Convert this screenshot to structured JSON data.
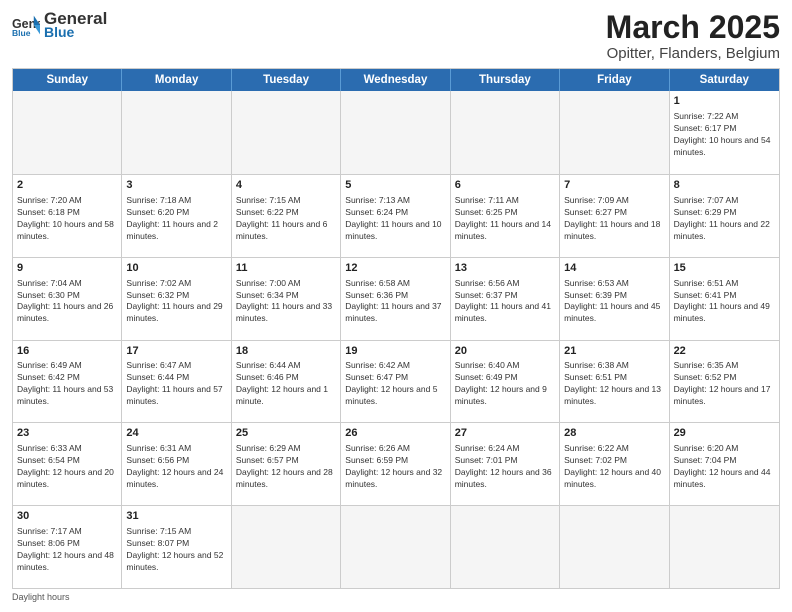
{
  "header": {
    "logo_general": "General",
    "logo_blue": "Blue",
    "month": "March 2025",
    "location": "Opitter, Flanders, Belgium"
  },
  "days": [
    "Sunday",
    "Monday",
    "Tuesday",
    "Wednesday",
    "Thursday",
    "Friday",
    "Saturday"
  ],
  "weeks": [
    [
      {
        "day": "",
        "empty": true
      },
      {
        "day": "",
        "empty": true
      },
      {
        "day": "",
        "empty": true
      },
      {
        "day": "",
        "empty": true
      },
      {
        "day": "",
        "empty": true
      },
      {
        "day": "",
        "empty": true
      },
      {
        "day": "1",
        "sunrise": "Sunrise: 7:22 AM",
        "sunset": "Sunset: 6:17 PM",
        "daylight": "Daylight: 10 hours and 54 minutes."
      }
    ],
    [
      {
        "day": "2",
        "sunrise": "Sunrise: 7:20 AM",
        "sunset": "Sunset: 6:18 PM",
        "daylight": "Daylight: 10 hours and 58 minutes."
      },
      {
        "day": "3",
        "sunrise": "Sunrise: 7:18 AM",
        "sunset": "Sunset: 6:20 PM",
        "daylight": "Daylight: 11 hours and 2 minutes."
      },
      {
        "day": "4",
        "sunrise": "Sunrise: 7:15 AM",
        "sunset": "Sunset: 6:22 PM",
        "daylight": "Daylight: 11 hours and 6 minutes."
      },
      {
        "day": "5",
        "sunrise": "Sunrise: 7:13 AM",
        "sunset": "Sunset: 6:24 PM",
        "daylight": "Daylight: 11 hours and 10 minutes."
      },
      {
        "day": "6",
        "sunrise": "Sunrise: 7:11 AM",
        "sunset": "Sunset: 6:25 PM",
        "daylight": "Daylight: 11 hours and 14 minutes."
      },
      {
        "day": "7",
        "sunrise": "Sunrise: 7:09 AM",
        "sunset": "Sunset: 6:27 PM",
        "daylight": "Daylight: 11 hours and 18 minutes."
      },
      {
        "day": "8",
        "sunrise": "Sunrise: 7:07 AM",
        "sunset": "Sunset: 6:29 PM",
        "daylight": "Daylight: 11 hours and 22 minutes."
      }
    ],
    [
      {
        "day": "9",
        "sunrise": "Sunrise: 7:04 AM",
        "sunset": "Sunset: 6:30 PM",
        "daylight": "Daylight: 11 hours and 26 minutes."
      },
      {
        "day": "10",
        "sunrise": "Sunrise: 7:02 AM",
        "sunset": "Sunset: 6:32 PM",
        "daylight": "Daylight: 11 hours and 29 minutes."
      },
      {
        "day": "11",
        "sunrise": "Sunrise: 7:00 AM",
        "sunset": "Sunset: 6:34 PM",
        "daylight": "Daylight: 11 hours and 33 minutes."
      },
      {
        "day": "12",
        "sunrise": "Sunrise: 6:58 AM",
        "sunset": "Sunset: 6:36 PM",
        "daylight": "Daylight: 11 hours and 37 minutes."
      },
      {
        "day": "13",
        "sunrise": "Sunrise: 6:56 AM",
        "sunset": "Sunset: 6:37 PM",
        "daylight": "Daylight: 11 hours and 41 minutes."
      },
      {
        "day": "14",
        "sunrise": "Sunrise: 6:53 AM",
        "sunset": "Sunset: 6:39 PM",
        "daylight": "Daylight: 11 hours and 45 minutes."
      },
      {
        "day": "15",
        "sunrise": "Sunrise: 6:51 AM",
        "sunset": "Sunset: 6:41 PM",
        "daylight": "Daylight: 11 hours and 49 minutes."
      }
    ],
    [
      {
        "day": "16",
        "sunrise": "Sunrise: 6:49 AM",
        "sunset": "Sunset: 6:42 PM",
        "daylight": "Daylight: 11 hours and 53 minutes."
      },
      {
        "day": "17",
        "sunrise": "Sunrise: 6:47 AM",
        "sunset": "Sunset: 6:44 PM",
        "daylight": "Daylight: 11 hours and 57 minutes."
      },
      {
        "day": "18",
        "sunrise": "Sunrise: 6:44 AM",
        "sunset": "Sunset: 6:46 PM",
        "daylight": "Daylight: 12 hours and 1 minute."
      },
      {
        "day": "19",
        "sunrise": "Sunrise: 6:42 AM",
        "sunset": "Sunset: 6:47 PM",
        "daylight": "Daylight: 12 hours and 5 minutes."
      },
      {
        "day": "20",
        "sunrise": "Sunrise: 6:40 AM",
        "sunset": "Sunset: 6:49 PM",
        "daylight": "Daylight: 12 hours and 9 minutes."
      },
      {
        "day": "21",
        "sunrise": "Sunrise: 6:38 AM",
        "sunset": "Sunset: 6:51 PM",
        "daylight": "Daylight: 12 hours and 13 minutes."
      },
      {
        "day": "22",
        "sunrise": "Sunrise: 6:35 AM",
        "sunset": "Sunset: 6:52 PM",
        "daylight": "Daylight: 12 hours and 17 minutes."
      }
    ],
    [
      {
        "day": "23",
        "sunrise": "Sunrise: 6:33 AM",
        "sunset": "Sunset: 6:54 PM",
        "daylight": "Daylight: 12 hours and 20 minutes."
      },
      {
        "day": "24",
        "sunrise": "Sunrise: 6:31 AM",
        "sunset": "Sunset: 6:56 PM",
        "daylight": "Daylight: 12 hours and 24 minutes."
      },
      {
        "day": "25",
        "sunrise": "Sunrise: 6:29 AM",
        "sunset": "Sunset: 6:57 PM",
        "daylight": "Daylight: 12 hours and 28 minutes."
      },
      {
        "day": "26",
        "sunrise": "Sunrise: 6:26 AM",
        "sunset": "Sunset: 6:59 PM",
        "daylight": "Daylight: 12 hours and 32 minutes."
      },
      {
        "day": "27",
        "sunrise": "Sunrise: 6:24 AM",
        "sunset": "Sunset: 7:01 PM",
        "daylight": "Daylight: 12 hours and 36 minutes."
      },
      {
        "day": "28",
        "sunrise": "Sunrise: 6:22 AM",
        "sunset": "Sunset: 7:02 PM",
        "daylight": "Daylight: 12 hours and 40 minutes."
      },
      {
        "day": "29",
        "sunrise": "Sunrise: 6:20 AM",
        "sunset": "Sunset: 7:04 PM",
        "daylight": "Daylight: 12 hours and 44 minutes."
      }
    ],
    [
      {
        "day": "30",
        "sunrise": "Sunrise: 7:17 AM",
        "sunset": "Sunset: 8:06 PM",
        "daylight": "Daylight: 12 hours and 48 minutes."
      },
      {
        "day": "31",
        "sunrise": "Sunrise: 7:15 AM",
        "sunset": "Sunset: 8:07 PM",
        "daylight": "Daylight: 12 hours and 52 minutes."
      },
      {
        "day": "",
        "empty": true
      },
      {
        "day": "",
        "empty": true
      },
      {
        "day": "",
        "empty": true
      },
      {
        "day": "",
        "empty": true
      },
      {
        "day": "",
        "empty": true
      }
    ]
  ],
  "footer": "Daylight hours"
}
